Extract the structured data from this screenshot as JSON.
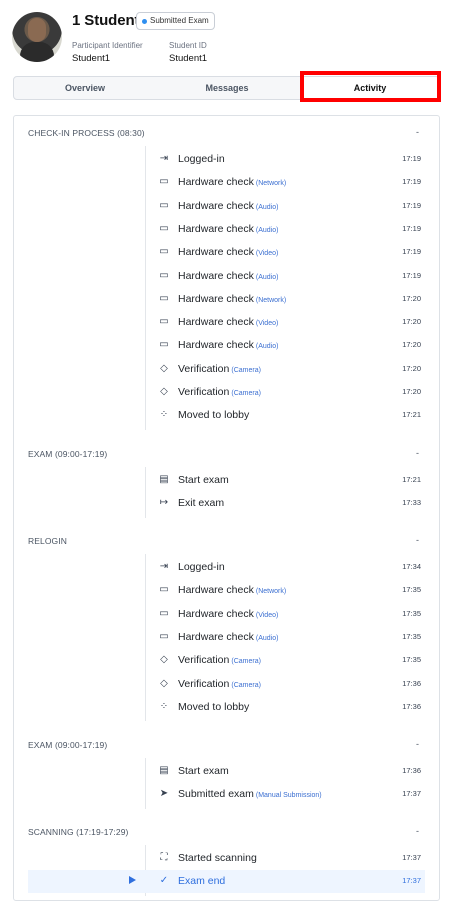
{
  "header": {
    "name": "1 Student",
    "badge": "Submitted Exam",
    "participant_label": "Participant Identifier",
    "participant_value": "Student1",
    "student_id_label": "Student ID",
    "student_id_value": "Student1"
  },
  "tabs": [
    "Overview",
    "Messages",
    "Activity"
  ],
  "active_tab": "Activity",
  "sections": [
    {
      "title": "CHECK-IN PROCESS (08:30)",
      "toggle": "-",
      "items": [
        {
          "icon": "login-icon",
          "label": "Logged-in",
          "sub": "",
          "time": "17:19"
        },
        {
          "icon": "laptop-icon",
          "label": "Hardware check",
          "sub": "(Network)",
          "time": "17:19"
        },
        {
          "icon": "laptop-icon",
          "label": "Hardware check",
          "sub": "(Audio)",
          "time": "17:19"
        },
        {
          "icon": "laptop-icon",
          "label": "Hardware check",
          "sub": "(Audio)",
          "time": "17:19"
        },
        {
          "icon": "laptop-icon",
          "label": "Hardware check",
          "sub": "(Video)",
          "time": "17:19"
        },
        {
          "icon": "laptop-icon",
          "label": "Hardware check",
          "sub": "(Audio)",
          "time": "17:19"
        },
        {
          "icon": "laptop-icon",
          "label": "Hardware check",
          "sub": "(Network)",
          "time": "17:20"
        },
        {
          "icon": "laptop-icon",
          "label": "Hardware check",
          "sub": "(Video)",
          "time": "17:20"
        },
        {
          "icon": "laptop-icon",
          "label": "Hardware check",
          "sub": "(Audio)",
          "time": "17:20"
        },
        {
          "icon": "shield-check-icon",
          "label": "Verification",
          "sub": "(Camera)",
          "time": "17:20"
        },
        {
          "icon": "shield-check-icon",
          "label": "Verification",
          "sub": "(Camera)",
          "time": "17:20"
        },
        {
          "icon": "loading-icon",
          "label": "Moved to lobby",
          "sub": "",
          "time": "17:21"
        }
      ]
    },
    {
      "title": "EXAM (09:00-17:19)",
      "toggle": "-",
      "items": [
        {
          "icon": "document-icon",
          "label": "Start exam",
          "sub": "",
          "time": "17:21"
        },
        {
          "icon": "logout-icon",
          "label": "Exit exam",
          "sub": "",
          "time": "17:33"
        }
      ]
    },
    {
      "title": "RELOGIN",
      "toggle": "-",
      "items": [
        {
          "icon": "login-icon",
          "label": "Logged-in",
          "sub": "",
          "time": "17:34"
        },
        {
          "icon": "laptop-icon",
          "label": "Hardware check",
          "sub": "(Network)",
          "time": "17:35"
        },
        {
          "icon": "laptop-icon",
          "label": "Hardware check",
          "sub": "(Video)",
          "time": "17:35"
        },
        {
          "icon": "laptop-icon",
          "label": "Hardware check",
          "sub": "(Audio)",
          "time": "17:35"
        },
        {
          "icon": "shield-check-icon",
          "label": "Verification",
          "sub": "(Camera)",
          "time": "17:35"
        },
        {
          "icon": "shield-check-icon",
          "label": "Verification",
          "sub": "(Camera)",
          "time": "17:36"
        },
        {
          "icon": "loading-icon",
          "label": "Moved to lobby",
          "sub": "",
          "time": "17:36"
        }
      ]
    },
    {
      "title": "EXAM (09:00-17:19)",
      "toggle": "-",
      "items": [
        {
          "icon": "document-icon",
          "label": "Start exam",
          "sub": "",
          "time": "17:36"
        },
        {
          "icon": "send-icon",
          "label": "Submitted exam",
          "sub": "(Manual Submission)",
          "time": "17:37"
        }
      ]
    },
    {
      "title": "SCANNING (17:19-17:29)",
      "toggle": "-",
      "items": [
        {
          "icon": "scan-icon",
          "label": "Started scanning",
          "sub": "",
          "time": "17:37"
        },
        {
          "icon": "check-icon",
          "label": "Exam end",
          "sub": "",
          "time": "17:37",
          "selected": true
        }
      ]
    }
  ],
  "colors": {
    "accent": "#2f6fde",
    "highlight_box": "#ff0000",
    "badge_dot": "#2f8ff0"
  }
}
